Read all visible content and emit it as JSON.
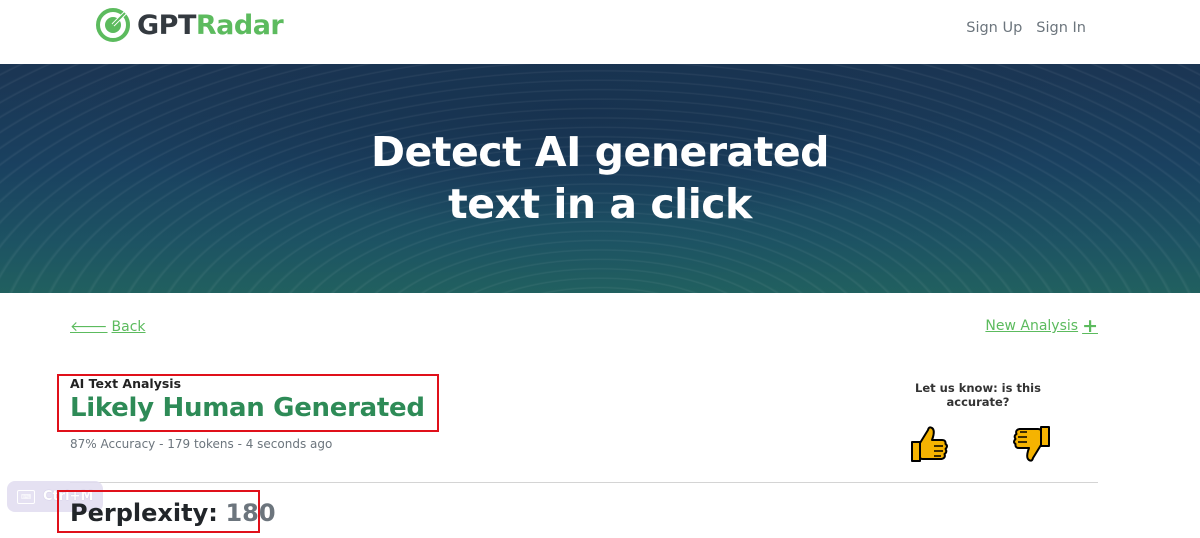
{
  "header": {
    "logo_gpt": "GPT",
    "logo_radar": "Radar",
    "nav": {
      "sign_up": "Sign Up",
      "sign_in": "Sign In"
    }
  },
  "hero": {
    "title_line1": "Detect AI generated",
    "title_line2": "text in a click"
  },
  "links": {
    "back": "Back",
    "new_analysis": "New Analysis"
  },
  "result": {
    "label": "AI Text Analysis",
    "verdict": "Likely Human Generated",
    "meta": "87% Accuracy - 179 tokens - 4 seconds ago"
  },
  "feedback": {
    "question": "Let us know: is this accurate?",
    "up_icon": "thumbs-up-icon",
    "down_icon": "thumbs-down-icon"
  },
  "metrics": {
    "perplexity_label": "Perplexity:",
    "perplexity_value": "180"
  },
  "overlay": {
    "shortcut": "Ctrl+M"
  },
  "colors": {
    "brand_green": "#5cbb5e",
    "verdict_green": "#2e8b57",
    "highlight_red": "#e0101a",
    "hero_dark": "#1b3553"
  }
}
